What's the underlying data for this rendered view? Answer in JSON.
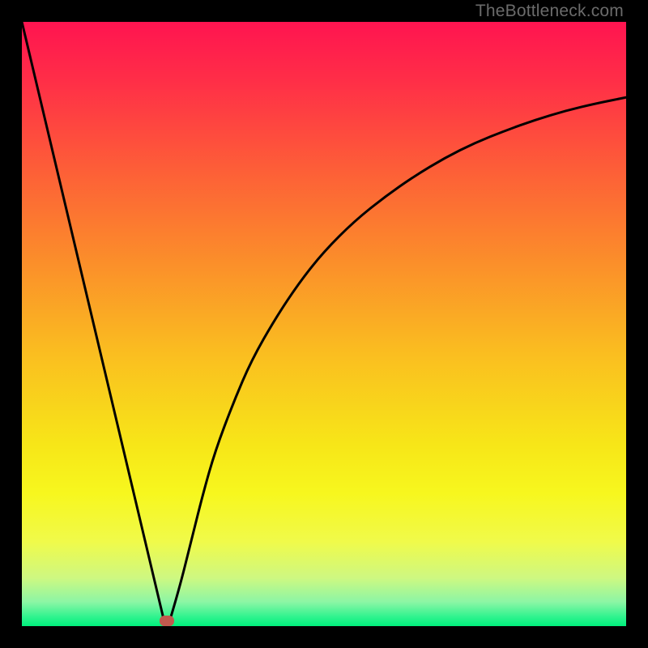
{
  "watermark": {
    "text": "TheBottleneck.com"
  },
  "chart_data": {
    "type": "line",
    "title": "",
    "xlabel": "",
    "ylabel": "",
    "xlim": [
      0,
      100
    ],
    "ylim": [
      0,
      100
    ],
    "grid": false,
    "legend": false,
    "background_gradient": {
      "stops": [
        {
          "offset": 0.0,
          "color": "#ff1450"
        },
        {
          "offset": 0.1,
          "color": "#ff2f47"
        },
        {
          "offset": 0.25,
          "color": "#fd6037"
        },
        {
          "offset": 0.4,
          "color": "#fb8f2a"
        },
        {
          "offset": 0.55,
          "color": "#fabe20"
        },
        {
          "offset": 0.7,
          "color": "#f7e618"
        },
        {
          "offset": 0.78,
          "color": "#f7f71e"
        },
        {
          "offset": 0.86,
          "color": "#f0fa4a"
        },
        {
          "offset": 0.92,
          "color": "#cef881"
        },
        {
          "offset": 0.96,
          "color": "#8cf6a5"
        },
        {
          "offset": 0.985,
          "color": "#2ef38e"
        },
        {
          "offset": 1.0,
          "color": "#00f07c"
        }
      ]
    },
    "series": [
      {
        "name": "left-branch",
        "x": [
          0,
          23.5
        ],
        "y": [
          100,
          1
        ]
      },
      {
        "name": "right-branch",
        "x": [
          24.5,
          26,
          28,
          30,
          32,
          35,
          38,
          42,
          46,
          50,
          55,
          60,
          65,
          70,
          75,
          80,
          85,
          90,
          95,
          100
        ],
        "y": [
          1,
          6,
          14,
          22,
          29,
          37,
          44,
          51,
          57,
          62,
          67,
          71,
          74.5,
          77.5,
          80,
          82,
          83.8,
          85.3,
          86.5,
          87.5
        ]
      }
    ],
    "marker": {
      "name": "optimum-point",
      "x": 24,
      "y": 1,
      "color": "#c1594e"
    }
  }
}
